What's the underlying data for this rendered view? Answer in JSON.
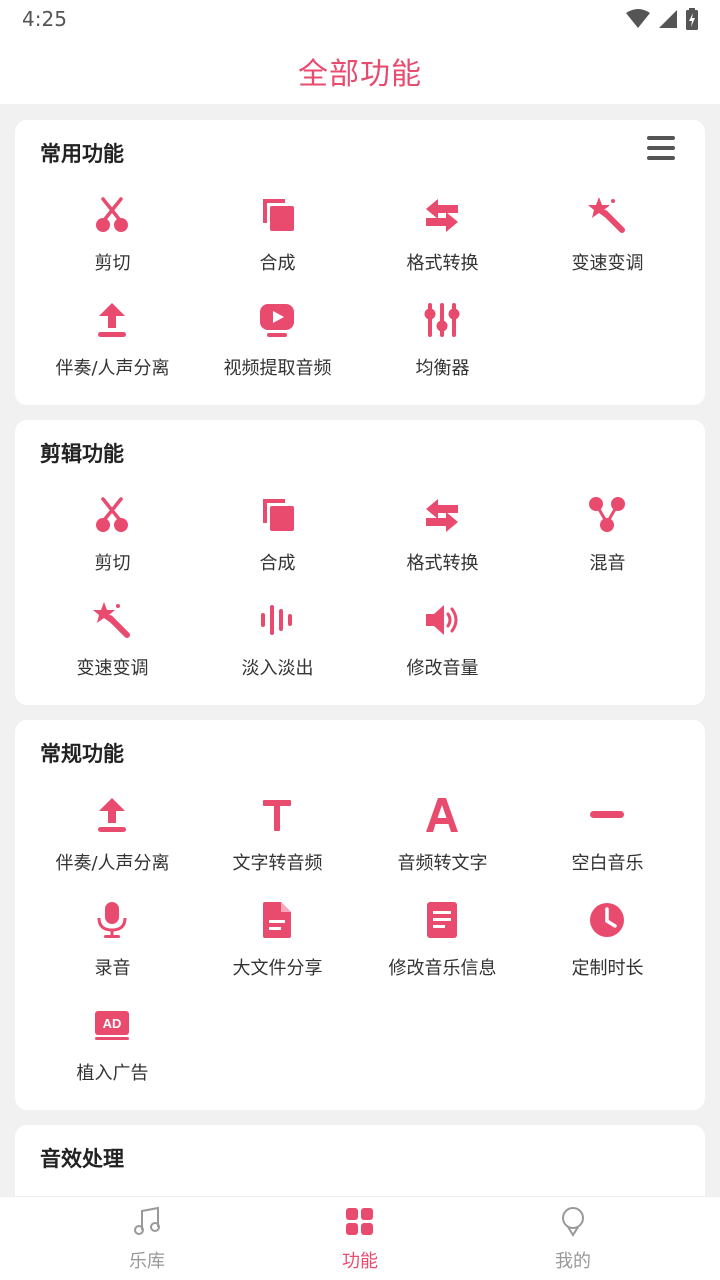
{
  "status_bar": {
    "time": "4:25"
  },
  "header": {
    "title": "全部功能"
  },
  "colors": {
    "accent": "#e94b6f",
    "inactive": "#999999"
  },
  "sections": [
    {
      "title": "常用功能",
      "items": [
        {
          "label": "剪切",
          "icon": "scissors-icon"
        },
        {
          "label": "合成",
          "icon": "copy-icon"
        },
        {
          "label": "格式转换",
          "icon": "swap-icon"
        },
        {
          "label": "变速变调",
          "icon": "magic-wand-icon"
        },
        {
          "label": "伴奏/人声分离",
          "icon": "upload-icon"
        },
        {
          "label": "视频提取音频",
          "icon": "video-play-icon"
        },
        {
          "label": "均衡器",
          "icon": "equalizer-icon"
        }
      ]
    },
    {
      "title": "剪辑功能",
      "items": [
        {
          "label": "剪切",
          "icon": "scissors-icon"
        },
        {
          "label": "合成",
          "icon": "copy-icon"
        },
        {
          "label": "格式转换",
          "icon": "swap-icon"
        },
        {
          "label": "混音",
          "icon": "merge-icon"
        },
        {
          "label": "变速变调",
          "icon": "magic-wand-icon"
        },
        {
          "label": "淡入淡出",
          "icon": "waveform-icon"
        },
        {
          "label": "修改音量",
          "icon": "volume-icon"
        }
      ]
    },
    {
      "title": "常规功能",
      "items": [
        {
          "label": "伴奏/人声分离",
          "icon": "upload-icon"
        },
        {
          "label": "文字转音频",
          "icon": "text-t-icon"
        },
        {
          "label": "音频转文字",
          "icon": "letter-a-icon"
        },
        {
          "label": "空白音乐",
          "icon": "minus-icon"
        },
        {
          "label": "录音",
          "icon": "microphone-icon"
        },
        {
          "label": "大文件分享",
          "icon": "file-icon"
        },
        {
          "label": "修改音乐信息",
          "icon": "document-icon"
        },
        {
          "label": "定制时长",
          "icon": "clock-icon"
        },
        {
          "label": "植入广告",
          "icon": "ad-icon"
        }
      ]
    },
    {
      "title": "音效处理",
      "items": []
    }
  ],
  "bottom_nav": [
    {
      "label": "乐库",
      "icon": "music-note-icon",
      "active": false
    },
    {
      "label": "功能",
      "icon": "grid-icon",
      "active": true
    },
    {
      "label": "我的",
      "icon": "profile-icon",
      "active": false
    }
  ]
}
